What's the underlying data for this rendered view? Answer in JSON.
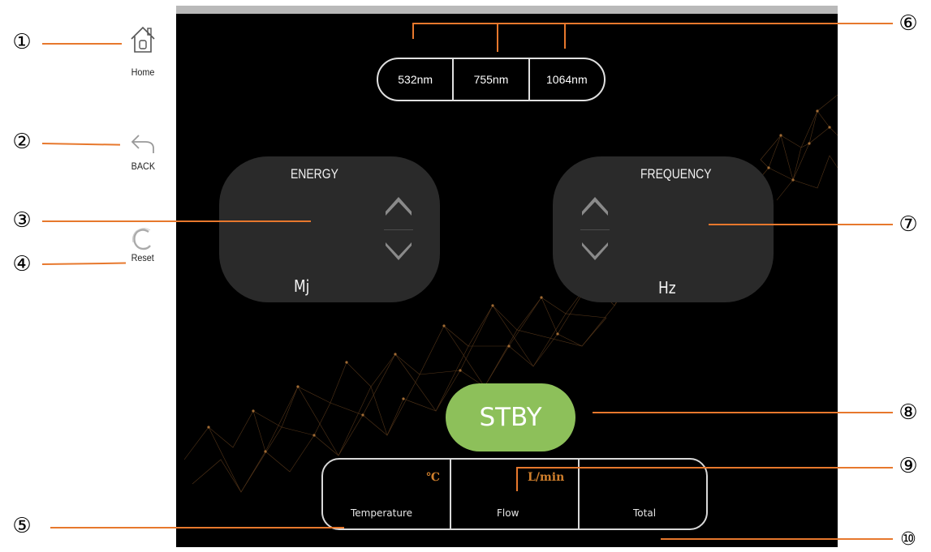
{
  "sidebar": {
    "home_label": "Home",
    "back_label": "BACK",
    "reset_label": "Reset"
  },
  "wavelengths": [
    "532nm",
    "755nm",
    "1064nm"
  ],
  "energy": {
    "title": "ENERGY",
    "unit": "Mj"
  },
  "frequency": {
    "title": "FREQUENCY",
    "unit": "Hz"
  },
  "stby_label": "STBY",
  "status": {
    "temperature": {
      "label": "Temperature",
      "unit": "℃"
    },
    "flow": {
      "label": "Flow",
      "unit": "L/min"
    },
    "total": {
      "label": "Total"
    }
  },
  "callouts": [
    "①",
    "②",
    "③",
    "④",
    "⑤",
    "⑥",
    "⑦",
    "⑧",
    "⑨",
    "⑩"
  ],
  "colors": {
    "callout_line": "#e7782d",
    "stby_button": "#8dc05a",
    "panel": "#2a2a2a",
    "screen_bg": "#000000",
    "unit_text": "#d07f2c"
  }
}
